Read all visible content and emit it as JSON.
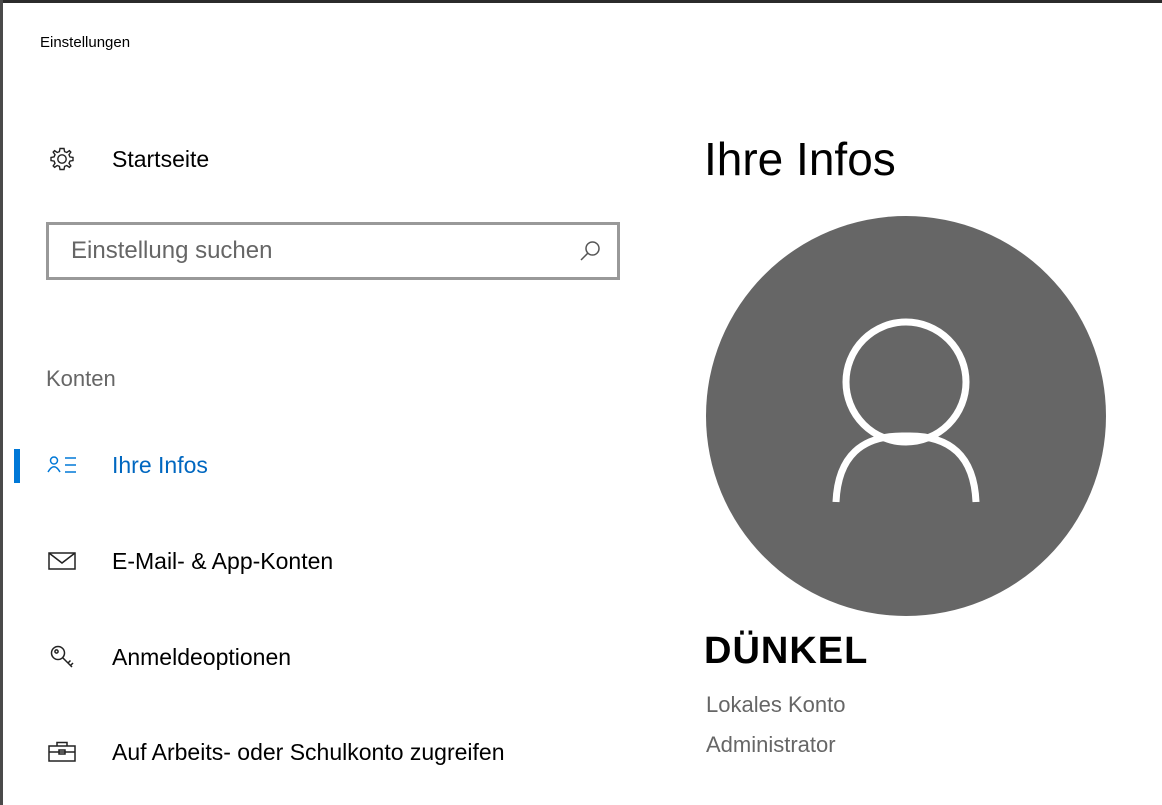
{
  "window": {
    "title": "Einstellungen"
  },
  "sidebar": {
    "home_label": "Startseite",
    "search": {
      "value": "",
      "placeholder": "Einstellung suchen"
    },
    "section_title": "Konten",
    "items": [
      {
        "label": "Ihre Infos",
        "icon": "person-list-icon",
        "active": true
      },
      {
        "label": "E-Mail- & App-Konten",
        "icon": "mail-icon",
        "active": false
      },
      {
        "label": "Anmeldeoptionen",
        "icon": "key-icon",
        "active": false
      },
      {
        "label": "Auf Arbeits- oder Schulkonto zugreifen",
        "icon": "briefcase-icon",
        "active": false
      }
    ]
  },
  "main": {
    "title": "Ihre Infos",
    "user": {
      "name": "DÜNKEL",
      "account_type": "Lokales Konto",
      "role": "Administrator"
    }
  },
  "colors": {
    "accent": "#0078d7",
    "accent_text": "#0067c0",
    "avatar_bg": "#666666",
    "secondary_text": "#666666"
  }
}
